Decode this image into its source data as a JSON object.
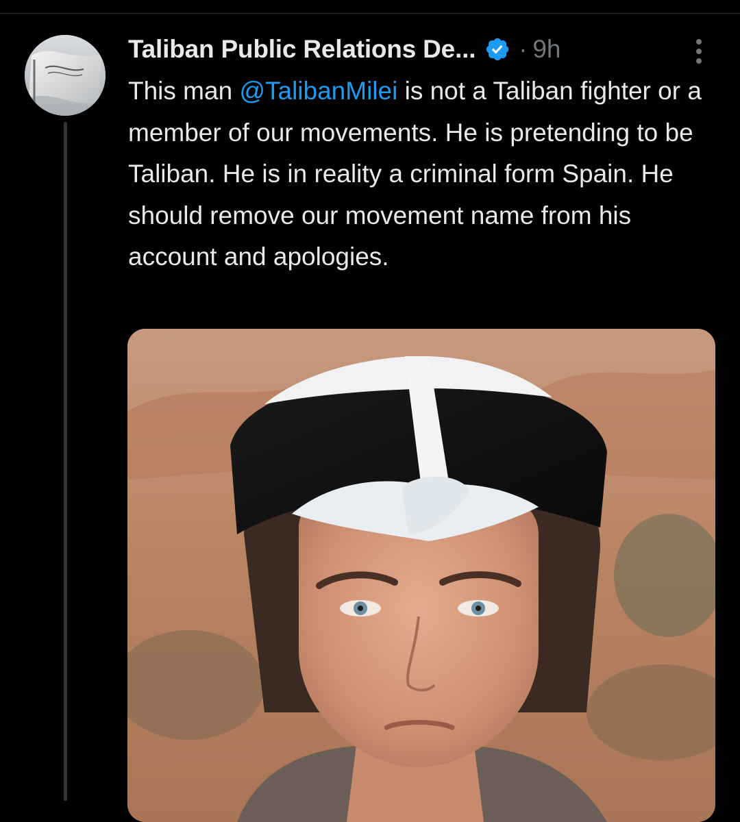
{
  "tweet": {
    "author": {
      "display_name": "Taliban Public Relations De...",
      "avatar_icon": "white-flag-avatar",
      "verified_icon": "verified-badge-icon",
      "verified_color": "#1d9bf0"
    },
    "separator": "·",
    "timestamp": "9h",
    "more_icon": "more-vertical-icon",
    "text": {
      "before_mention": "This man ",
      "mention": "@TalibanMilei",
      "after_mention": " is not a Taliban fighter or a member of our movements. He is pretending to be Taliban. He is in reality a criminal form Spain. He should remove our movement name from his account and apologies."
    },
    "media": {
      "type": "photo"
    }
  },
  "colors": {
    "background": "#000000",
    "text_primary": "#e7e9ea",
    "text_secondary": "#71767b",
    "link": "#1d9bf0",
    "divider": "#2f3336"
  }
}
